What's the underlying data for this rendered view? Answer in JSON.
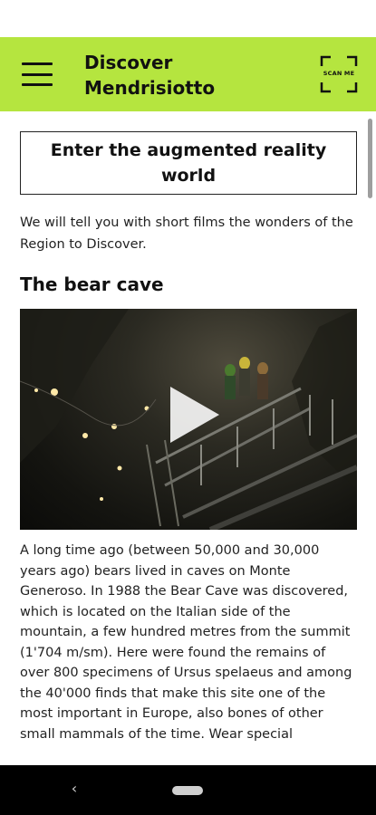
{
  "app_bar": {
    "title": "Discover Mendrisiotto",
    "scan_label": "SCAN ME",
    "menu_icon": "hamburger-menu-icon",
    "scan_icon": "scan-frame-icon",
    "color": "#b5e53f"
  },
  "main": {
    "ar_button_label": "Enter the augmented reality world",
    "intro_text": "We will tell you with short films the wonders of the Region to Discover.",
    "section_title": "The bear cave",
    "video_icon": "play-icon",
    "body_text": "A long time ago (between 50,000 and 30,000 years ago) bears lived in caves on Monte Generoso. In 1988 the Bear Cave was discovered, which is located on the Italian side of the mountain, a few hundred metres from the summit (1'704 m/sm). Here were found the remains of over 800 specimens of Ursus spelaeus and among the 40'000 finds that make this site one of the most important in Europe, also bones of other small mammals of the time. Wear special"
  },
  "nav_bar": {
    "back_glyph": "‹",
    "back_icon": "back-chevron-icon",
    "home_icon": "home-pill-icon"
  }
}
